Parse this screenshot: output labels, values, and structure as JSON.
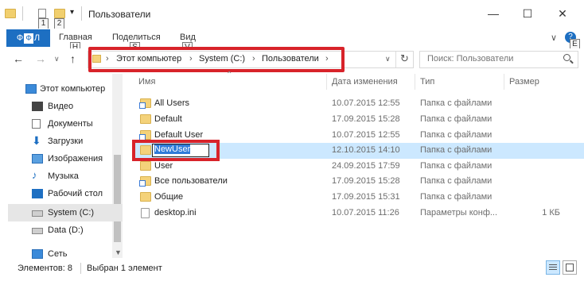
{
  "window": {
    "title": "Пользователи",
    "minimize_glyph": "—",
    "maximize_glyph": "☐",
    "close_glyph": "✕"
  },
  "quick_access": {
    "keytip_1": "1",
    "keytip_2": "2",
    "dropdown_glyph": "▾"
  },
  "ribbon": {
    "file_label": "Ф",
    "file_label_full": "Ф",
    "tabs": [
      {
        "label": "Главная",
        "keytip": "H"
      },
      {
        "label": "Поделиться",
        "keytip": "S"
      },
      {
        "label": "Вид",
        "keytip": "V"
      }
    ],
    "expand_glyph": "∨",
    "help_glyph": "?",
    "help_keytip": "E"
  },
  "nav": {
    "back": "←",
    "forward": "→",
    "dropdown": "∨",
    "up": "↑"
  },
  "address": {
    "crumbs": [
      "Этот компьютер",
      "System (C:)",
      "Пользователи"
    ],
    "separator": "›",
    "history_glyph": "∨",
    "refresh_glyph": "↻"
  },
  "search": {
    "placeholder": "Поиск: Пользователи",
    "icon": "search-icon"
  },
  "sidebar": {
    "items": [
      {
        "label": "Этот компьютер",
        "icon": "computer-icon"
      },
      {
        "label": "Видео",
        "icon": "video-icon"
      },
      {
        "label": "Документы",
        "icon": "documents-icon"
      },
      {
        "label": "Загрузки",
        "icon": "downloads-icon"
      },
      {
        "label": "Изображения",
        "icon": "pictures-icon"
      },
      {
        "label": "Музыка",
        "icon": "music-icon"
      },
      {
        "label": "Рабочий стол",
        "icon": "desktop-icon"
      },
      {
        "label": "System (C:)",
        "icon": "drive-icon"
      },
      {
        "label": "Data (D:)",
        "icon": "drive-icon"
      },
      {
        "label": "Сеть",
        "icon": "network-icon"
      }
    ]
  },
  "columns": {
    "name": "Имя",
    "date": "Дата изменения",
    "type": "Тип",
    "size": "Размер"
  },
  "files": [
    {
      "name": "All Users",
      "date": "10.07.2015 12:55",
      "type": "Папка с файлами",
      "size": ""
    },
    {
      "name": "Default",
      "date": "17.09.2015 15:28",
      "type": "Папка с файлами",
      "size": ""
    },
    {
      "name": "Default User",
      "date": "10.07.2015 12:55",
      "type": "Папка с файлами",
      "size": ""
    },
    {
      "name": "NewUser",
      "date": "12.10.2015 14:10",
      "type": "Папка с файлами",
      "size": ""
    },
    {
      "name": "User",
      "date": "24.09.2015 17:59",
      "type": "Папка с файлами",
      "size": ""
    },
    {
      "name": "Все пользователи",
      "date": "17.09.2015 15:28",
      "type": "Папка с файлами",
      "size": ""
    },
    {
      "name": "Общие",
      "date": "17.09.2015 15:31",
      "type": "Папка с файлами",
      "size": ""
    },
    {
      "name": "desktop.ini",
      "date": "10.07.2015 11:26",
      "type": "Параметры конф...",
      "size": "1 КБ"
    }
  ],
  "status": {
    "count": "Элементов: 8",
    "selected": "Выбран 1 элемент"
  },
  "colors": {
    "accent": "#1d6fc2",
    "selection": "#cce8ff",
    "highlight_box": "#d8232a"
  }
}
